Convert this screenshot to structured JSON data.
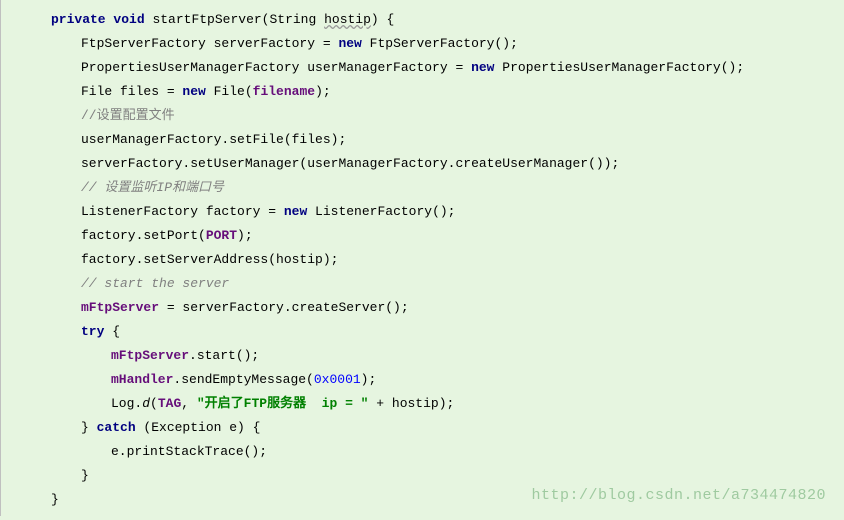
{
  "code": {
    "l1_kw1": "private",
    "l1_kw2": "void",
    "l1_method": "startFtpServer(String ",
    "l1_param": "hostip",
    "l1_close": ") {",
    "l2_a": "FtpServerFactory serverFactory = ",
    "l2_kw": "new",
    "l2_b": " FtpServerFactory();",
    "l3_a": "PropertiesUserManagerFactory userManagerFactory = ",
    "l3_kw": "new",
    "l3_b": " PropertiesUserManagerFactory();",
    "l4_a": "File files = ",
    "l4_kw": "new",
    "l4_b": " File(",
    "l4_field": "filename",
    "l4_c": ");",
    "l5": "//设置配置文件",
    "l6": "userManagerFactory.setFile(files);",
    "l7": "serverFactory.setUserManager(userManagerFactory.createUserManager());",
    "l8": "// 设置监听IP和端口号",
    "l9_a": "ListenerFactory factory = ",
    "l9_kw": "new",
    "l9_b": " ListenerFactory();",
    "l10_a": "factory.setPort(",
    "l10_field": "PORT",
    "l10_b": ");",
    "l11": "factory.setServerAddress(hostip);",
    "l12": "// start the server",
    "l13_field": "mFtpServer",
    "l13_b": " = serverFactory.createServer();",
    "l14_kw": "try",
    "l14_b": " {",
    "l15_field": "mFtpServer",
    "l15_b": ".start();",
    "l16_field": "mHandler",
    "l16_b": ".sendEmptyMessage(",
    "l16_num": "0x0001",
    "l16_c": ");",
    "l17_a": "Log.",
    "l17_method": "d",
    "l17_b": "(",
    "l17_field": "TAG",
    "l17_c": ", ",
    "l17_str": "\"开启了FTP服务器  ip = \"",
    "l17_d": " + hostip);",
    "l18_a": "} ",
    "l18_kw": "catch",
    "l18_b": " (Exception e) {",
    "l19": "e.printStackTrace();",
    "l20": "}",
    "l21": "}"
  },
  "watermark": "http://blog.csdn.net/a734474820"
}
